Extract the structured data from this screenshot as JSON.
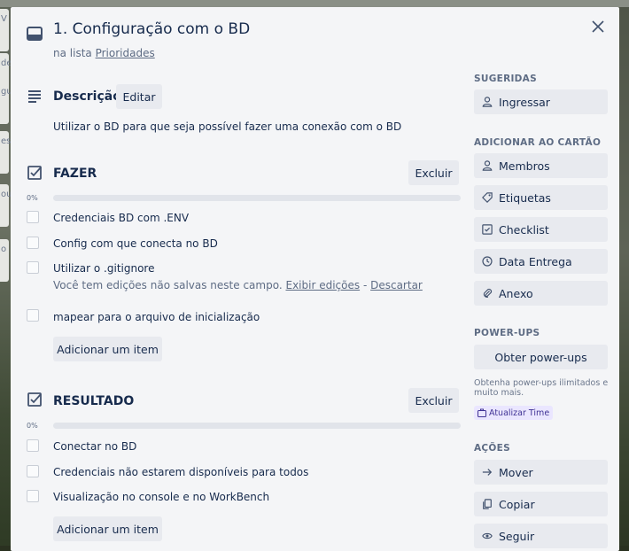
{
  "card": {
    "title": "1. Configuração com o BD",
    "list_prefix": "na lista",
    "list_name": "Prioridades"
  },
  "description": {
    "heading": "Descrição",
    "edit_label": "Editar",
    "text": "Utilizar o BD para que seja possível fazer uma conexão com o BD"
  },
  "checklists": [
    {
      "title": "FAZER",
      "delete_label": "Excluir",
      "percent_label": "0%",
      "progress": 0,
      "items": [
        {
          "text": "Credenciais BD com .ENV"
        },
        {
          "text": "Config com que conecta no BD"
        },
        {
          "text": "Utilizar o .gitignore"
        },
        {
          "text": "mapear para o arquivo de inicialização"
        }
      ],
      "unsaved": {
        "text": "Você tem edições não salvas neste campo.",
        "view_link": "Exibir edições",
        "separator": "-",
        "discard_link": "Descartar"
      },
      "add_item_label": "Adicionar um item"
    },
    {
      "title": "RESULTADO",
      "delete_label": "Excluir",
      "percent_label": "0%",
      "progress": 0,
      "items": [
        {
          "text": "Conectar no BD"
        },
        {
          "text": "Credenciais não estarem disponíveis para todos"
        },
        {
          "text": "Visualização no console e no WorkBench"
        }
      ],
      "add_item_label": "Adicionar um item"
    }
  ],
  "sidebar": {
    "suggested_heading": "SUGERIDAS",
    "join_label": "Ingressar",
    "add_heading": "ADICIONAR AO CARTÃO",
    "add_buttons": [
      {
        "label": "Membros",
        "icon": "person-icon"
      },
      {
        "label": "Etiquetas",
        "icon": "tag-icon"
      },
      {
        "label": "Checklist",
        "icon": "checklist-icon"
      },
      {
        "label": "Data Entrega",
        "icon": "clock-icon"
      },
      {
        "label": "Anexo",
        "icon": "paperclip-icon"
      }
    ],
    "powerups_heading": "POWER-UPS",
    "get_powerups_label": "Obter power-ups",
    "powerups_note": "Obtenha power-ups ilimitados e muito mais.",
    "upgrade_label": "Atualizar Time",
    "actions_heading": "AÇÕES",
    "actions": [
      {
        "label": "Mover",
        "icon": "arrow-right-icon"
      },
      {
        "label": "Copiar",
        "icon": "copy-icon"
      },
      {
        "label": "Seguir",
        "icon": "eye-icon"
      }
    ]
  },
  "backdrop": {
    "card_fragments": [
      "V",
      "de",
      "gu",
      "es",
      "ou",
      "o"
    ]
  },
  "colors": {
    "modal_bg": "#f4f5f7",
    "button_bg": "#e8eaef",
    "progress_fill": "#5ba4cf",
    "badge_bg": "#eae6ff",
    "badge_text": "#403294"
  }
}
